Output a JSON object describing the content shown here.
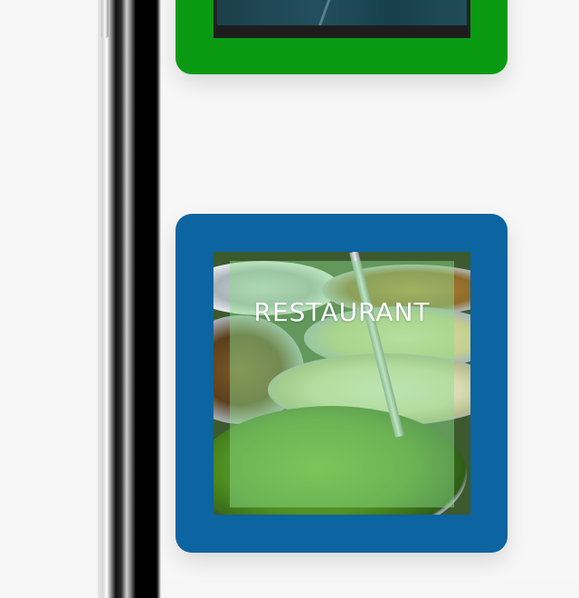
{
  "card": {
    "title": "RESTAURANT"
  },
  "colors": {
    "green_card": "#0a9a12",
    "blue_card": "#0c64a0",
    "overlay": "#8cdc8c"
  },
  "icons": [
    "phone-side-button"
  ]
}
